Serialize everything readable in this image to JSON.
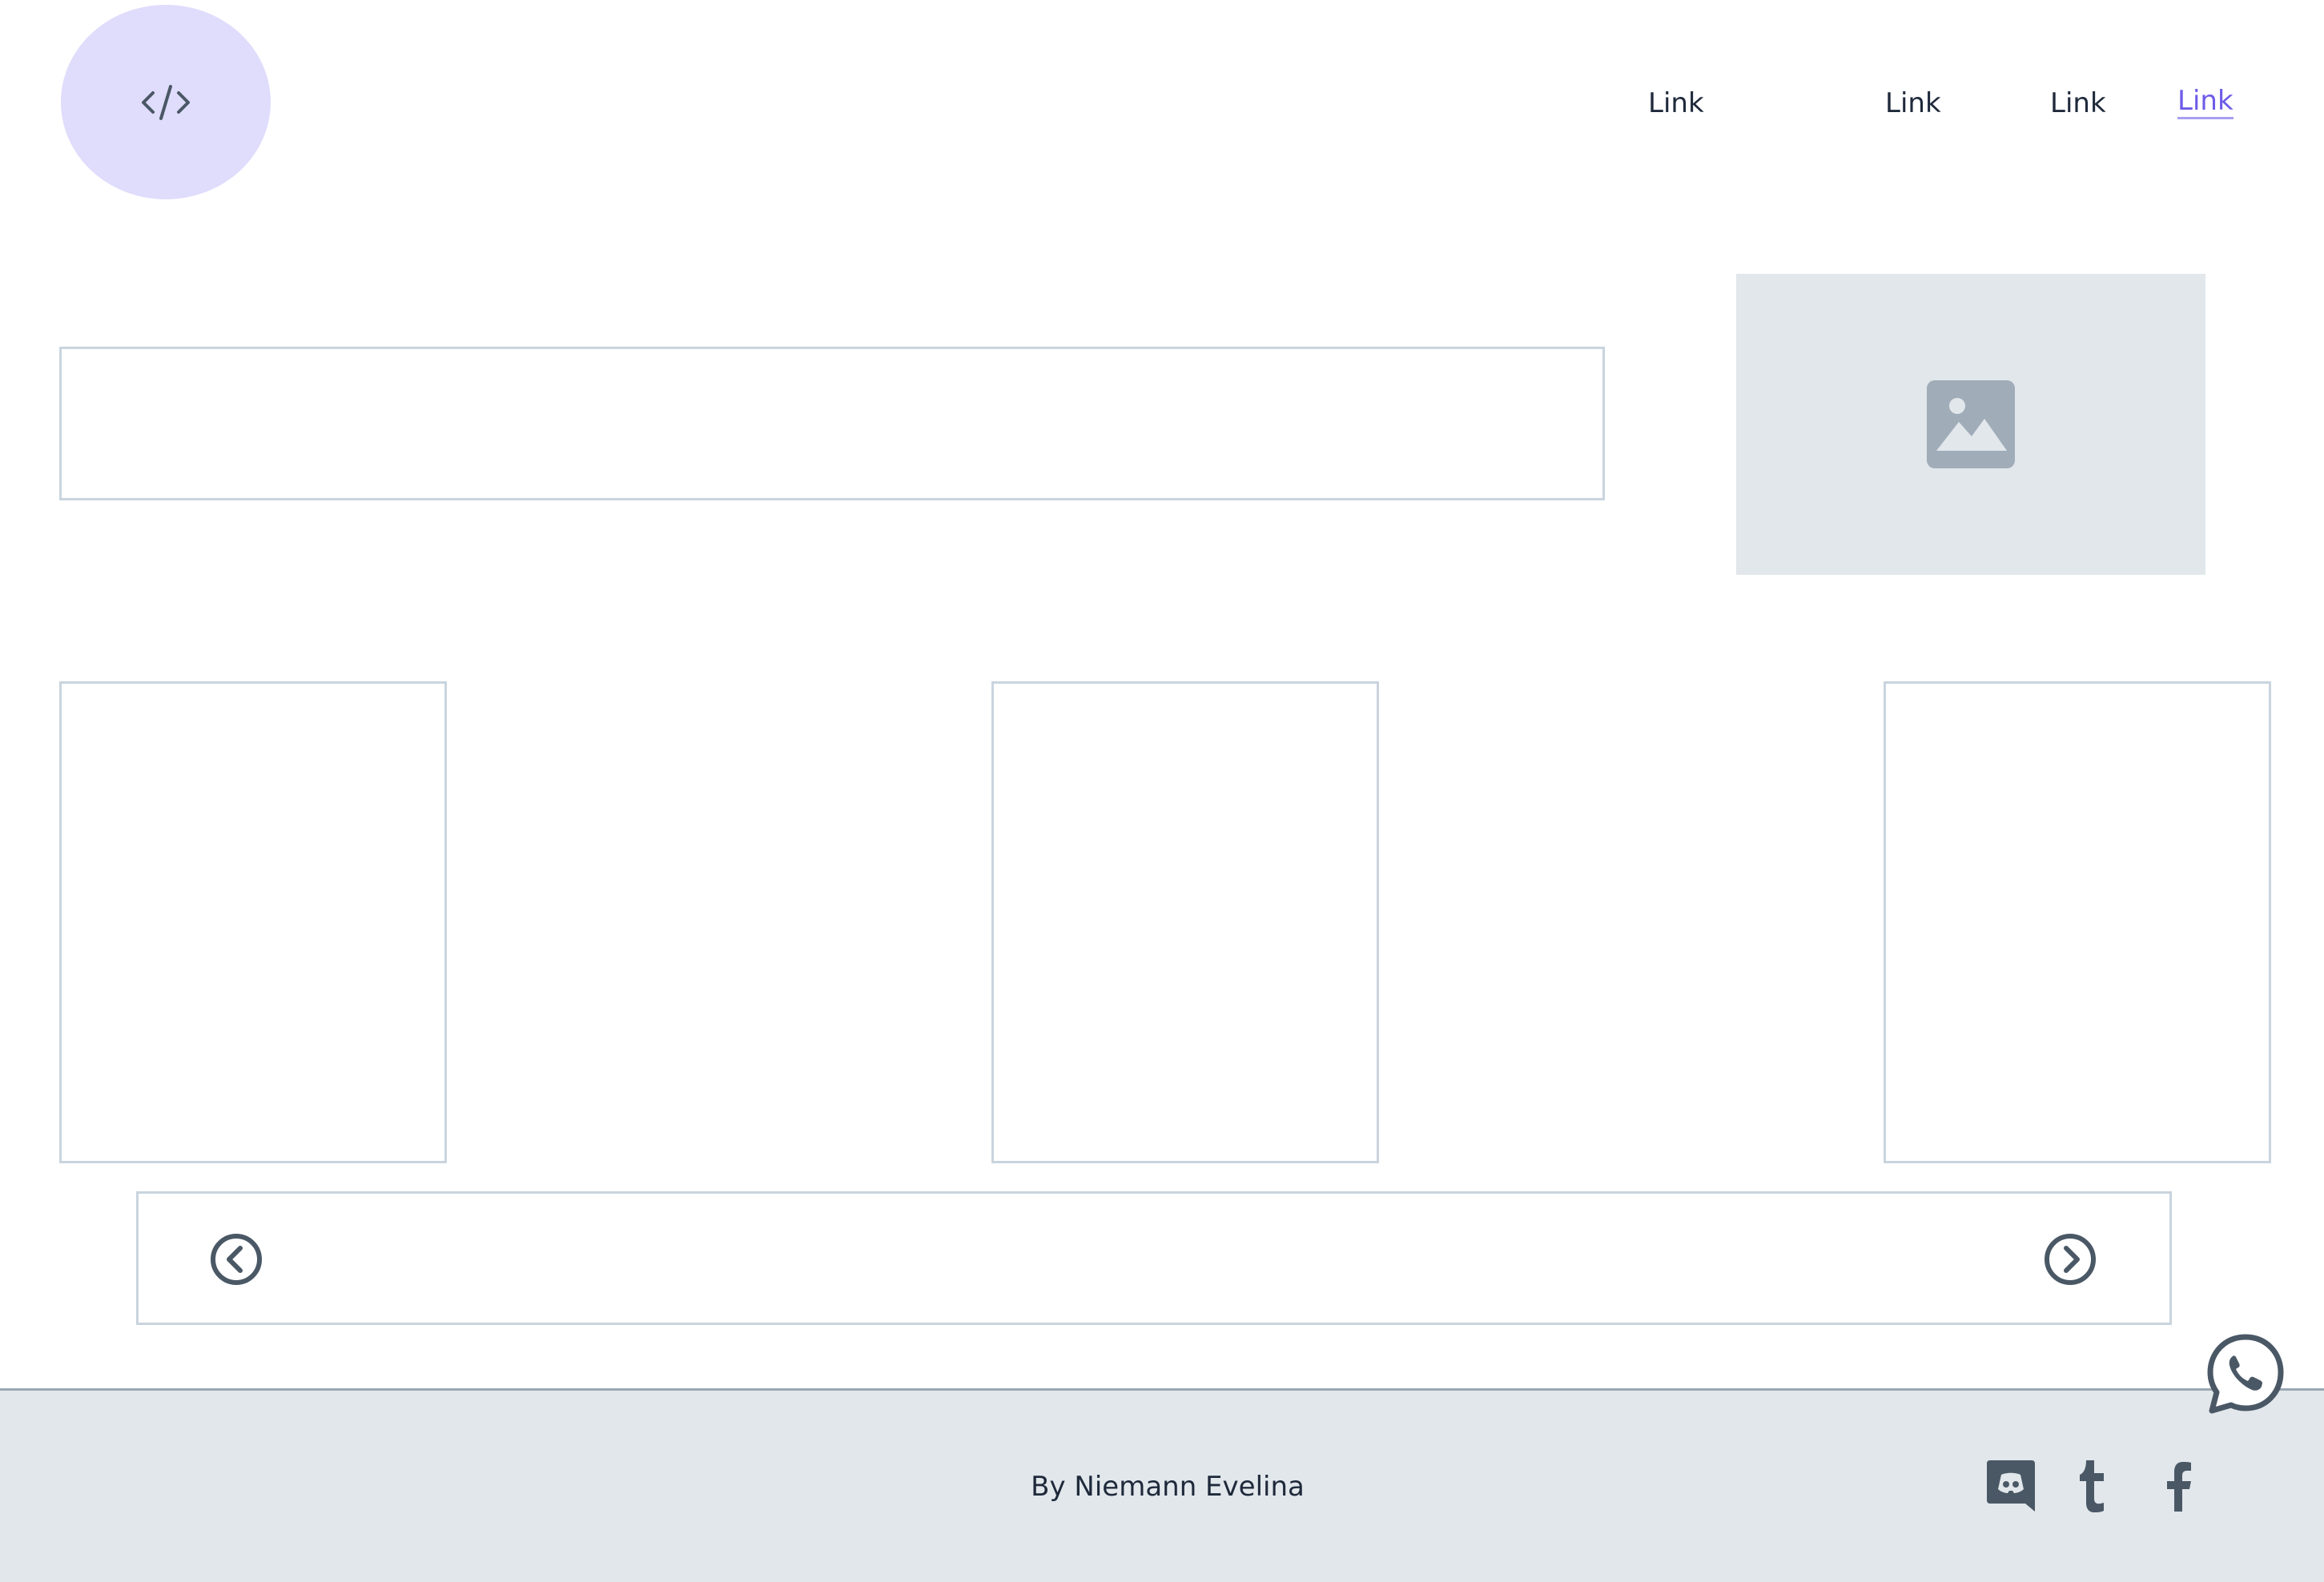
{
  "header": {
    "logo_icon": "code-icon",
    "nav": [
      {
        "label": "Link",
        "active": false
      },
      {
        "label": "Link",
        "active": false
      },
      {
        "label": "Link",
        "active": false
      },
      {
        "label": "Link",
        "active": true
      }
    ]
  },
  "hero": {
    "image_icon": "image-placeholder-icon"
  },
  "pager": {
    "prev_icon": "chevron-left-circle-icon",
    "next_icon": "chevron-right-circle-icon"
  },
  "floating": {
    "icon": "whatsapp-icon"
  },
  "footer": {
    "credit": "By Niemann Evelina",
    "social_icons": [
      "discord-icon",
      "tumblr-icon",
      "facebook-icon"
    ]
  },
  "colors": {
    "accent": "#6d5ce8",
    "logo_bg": "#e0dcfc",
    "border": "#c9d4de",
    "placeholder_bg": "#e2e7eb",
    "icon": "#4a5866",
    "text": "#1e293b"
  }
}
